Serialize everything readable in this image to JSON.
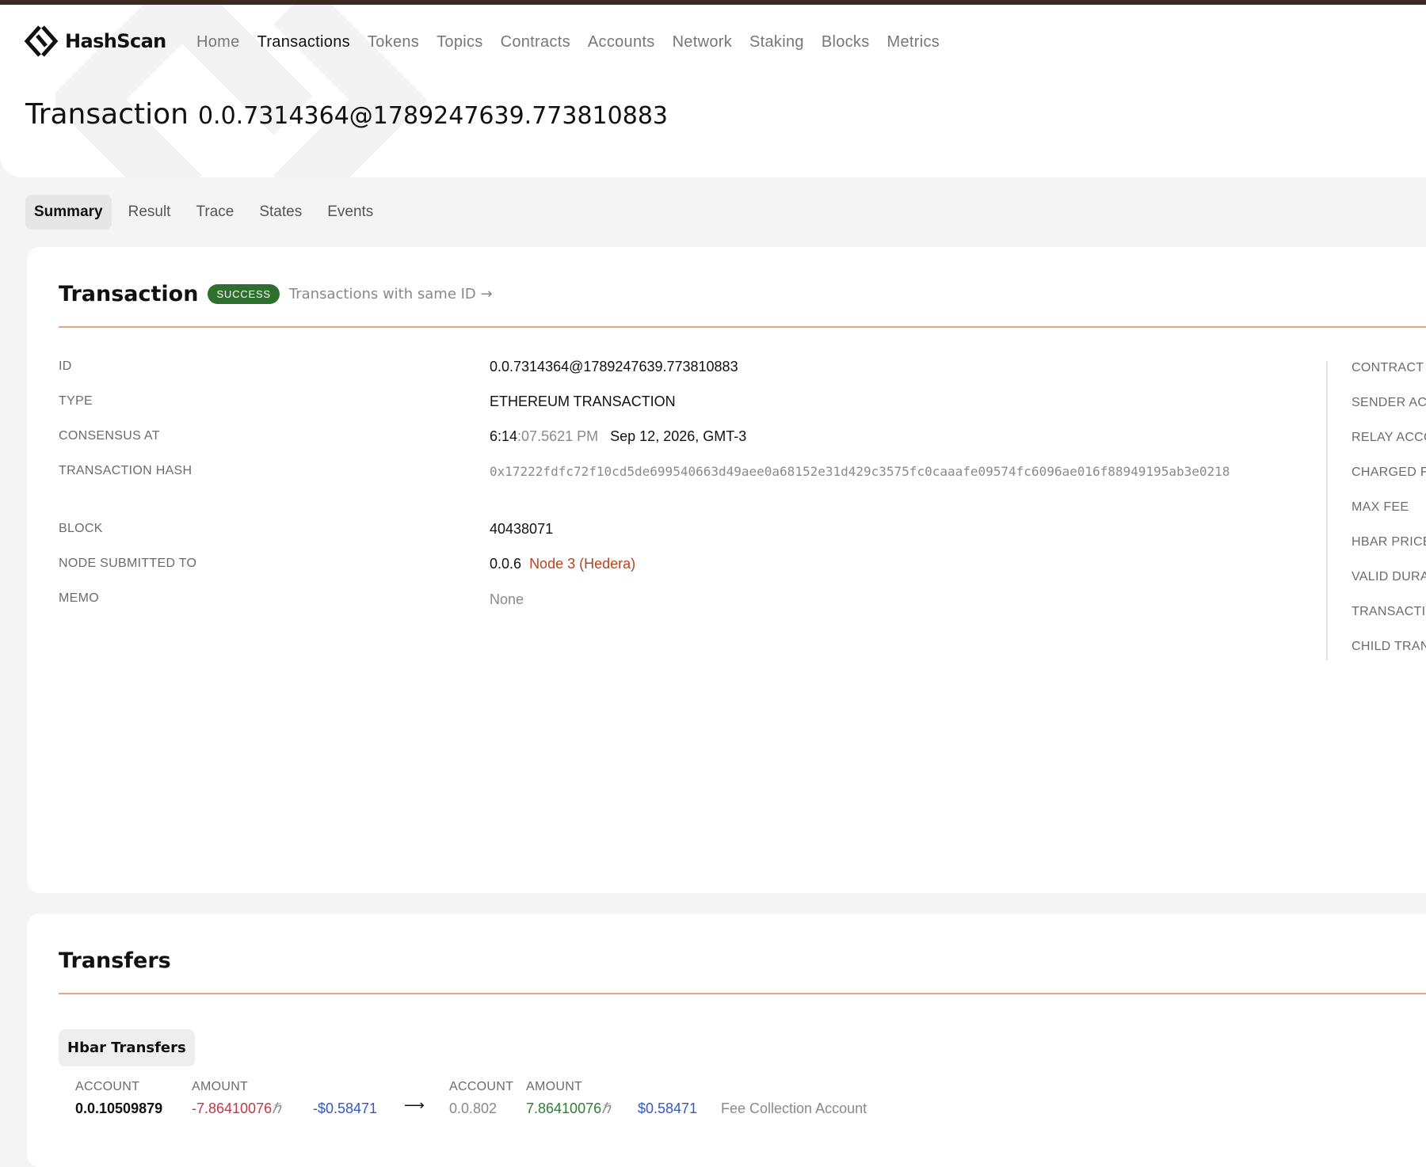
{
  "app": {
    "name": "HashScan"
  },
  "nav": {
    "items": [
      {
        "label": "Home",
        "active": false
      },
      {
        "label": "Transactions",
        "active": true
      },
      {
        "label": "Tokens",
        "active": false
      },
      {
        "label": "Topics",
        "active": false
      },
      {
        "label": "Contracts",
        "active": false
      },
      {
        "label": "Accounts",
        "active": false
      },
      {
        "label": "Network",
        "active": false
      },
      {
        "label": "Staking",
        "active": false
      },
      {
        "label": "Blocks",
        "active": false
      },
      {
        "label": "Metrics",
        "active": false
      }
    ]
  },
  "page": {
    "title_word": "Transaction",
    "title_id": "0.0.7314364@1789247639.773810883"
  },
  "tabs": [
    {
      "label": "Summary",
      "active": true
    },
    {
      "label": "Result",
      "active": false
    },
    {
      "label": "Trace",
      "active": false
    },
    {
      "label": "States",
      "active": false
    },
    {
      "label": "Events",
      "active": false
    }
  ],
  "transaction_card": {
    "title": "Transaction",
    "status": "SUCCESS",
    "same_id_link": "Transactions with same ID →",
    "labels": {
      "id": "ID",
      "type": "TYPE",
      "consensus_at": "CONSENSUS AT",
      "transaction_hash": "TRANSACTION HASH",
      "block": "BLOCK",
      "node": "NODE SUBMITTED TO",
      "memo": "MEMO"
    },
    "values": {
      "id": "0.0.7314364@1789247639.773810883",
      "type": "ETHEREUM TRANSACTION",
      "consensus_time_main": "6:14",
      "consensus_time_rest": ":07.5621 PM",
      "consensus_date": "Sep 12, 2026, GMT-3",
      "transaction_hash": "0x17222fdfc72f10cd5de699540663d49aee0a68152e31d429c3575fc0caaafe09574fc6096ae016f88949195ab3e0218",
      "block": "40438071",
      "node_id": "0.0.6",
      "node_name": "Node 3 (Hedera)",
      "memo": "None"
    },
    "right_labels": [
      "CONTRACT",
      "SENDER ACC",
      "RELAY ACCO",
      "CHARGED FI",
      "MAX FEE",
      "HBAR PRICE",
      "VALID DURA",
      "TRANSACTIO",
      "CHILD TRAN"
    ]
  },
  "transfers_card": {
    "title": "Transfers",
    "hbar_button": "Hbar Transfers",
    "col_account": "ACCOUNT",
    "col_amount": "AMOUNT",
    "from_account": "0.0.10509879",
    "from_amount": "-7.86410076",
    "from_usd": "-$0.58471",
    "arrow": "⟶",
    "to_account": "0.0.802",
    "to_amount": "7.86410076",
    "to_usd": "$0.58471",
    "to_description": "Fee Collection Account",
    "hbar_symbol": "ℏ"
  },
  "colors": {
    "brand_dark": "#3b2a22",
    "accent_divider": "#e0a482",
    "success": "#2e6f30",
    "link": "#b5451b",
    "negative": "#c0384a",
    "positive": "#2e7d32",
    "usd": "#3557c2"
  }
}
